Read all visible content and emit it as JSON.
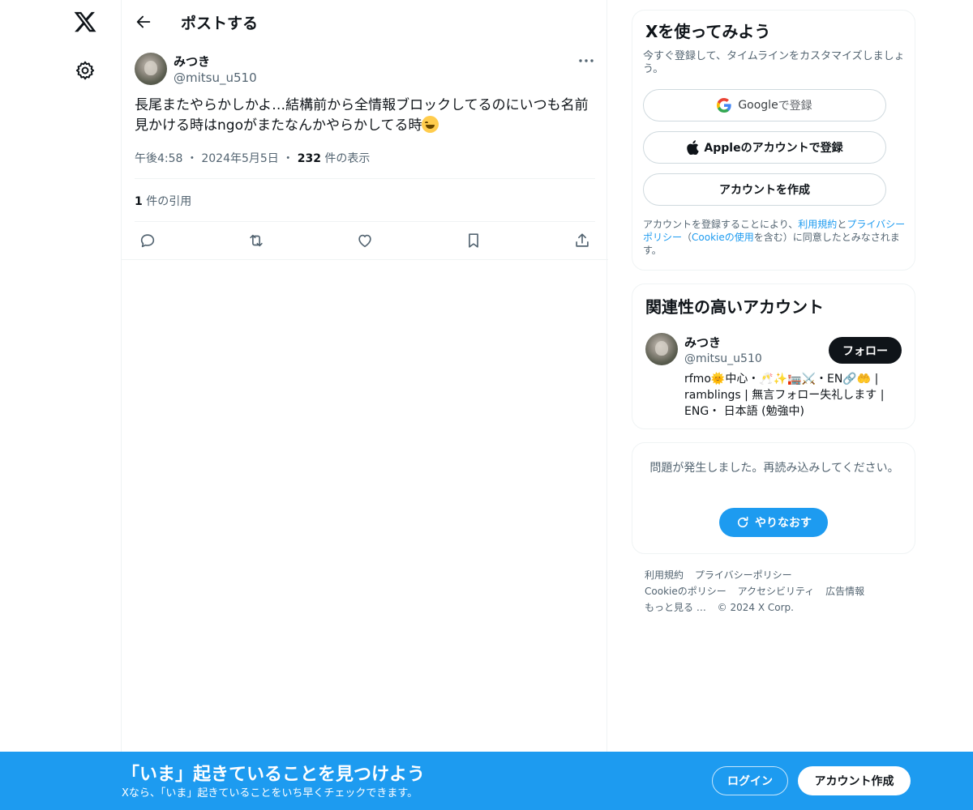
{
  "nav": {
    "logo_icon": "x-logo-icon",
    "settings_icon": "gear-icon"
  },
  "header": {
    "back_icon": "arrow-left-icon",
    "title": "ポストする"
  },
  "post": {
    "author_name": "みつき",
    "author_handle": "@mitsu_u510",
    "text": "長尾またやらかしかよ…結構前から全情報ブロックしてるのにいつも名前見かける時はngoがまたなんかやらかしてる時",
    "emoji": "sweat-smile-emoji",
    "time": "午後4:58",
    "sep1": "・",
    "date": "2024年5月5日",
    "sep2": "・",
    "views_count": "232",
    "views_label": " 件の表示",
    "quotes_count": "1",
    "quotes_label": " 件の引用",
    "actions": [
      "reply-icon",
      "repost-icon",
      "like-icon",
      "bookmark-icon",
      "share-icon"
    ]
  },
  "signup_panel": {
    "title": "Xを使ってみよう",
    "subtitle": "今すぐ登録して、タイムラインをカスタマイズしましょう。",
    "google_brand": "Google",
    "google_label": " で登録",
    "apple_label": "Appleのアカウントで登録",
    "create_label": "アカウントを作成",
    "legal_prefix": "アカウントを登録することにより、",
    "legal_terms": "利用規約",
    "legal_and": "と",
    "legal_privacy": "プライバシーポリシー",
    "legal_paren_open": "（",
    "legal_cookie": "Cookieの使用",
    "legal_suffix": "を含む）に同意したとみなされます。"
  },
  "related": {
    "title": "関連性の高いアカウント",
    "name": "みつき",
    "handle": "@mitsu_u510",
    "follow_label": "フォロー",
    "bio": "rfmo🌞中心・🥂✨🏣⚔️・EN🔗🤲 | ramblings | 無言フォロー失礼します | ENG・ 日本語 (勉強中)"
  },
  "error_panel": {
    "message": "問題が発生しました。再読み込みしてください。",
    "retry_label": "やりなおす"
  },
  "footer": {
    "links": [
      "利用規約",
      "プライバシーポリシー",
      "Cookieのポリシー",
      "アクセシビリティ",
      "広告情報",
      "もっと見る …"
    ],
    "copyright": "© 2024 X Corp."
  },
  "banner": {
    "title": "「いま」起きていることを見つけよう",
    "subtitle": "Xなら、「いま」起きていることをいち早くチェックできます。",
    "login_label": "ログイン",
    "signup_label": "アカウント作成"
  },
  "colors": {
    "accent": "#1d9bf0",
    "text": "#0f1419",
    "muted": "#536471",
    "border": "#eff3f4"
  }
}
